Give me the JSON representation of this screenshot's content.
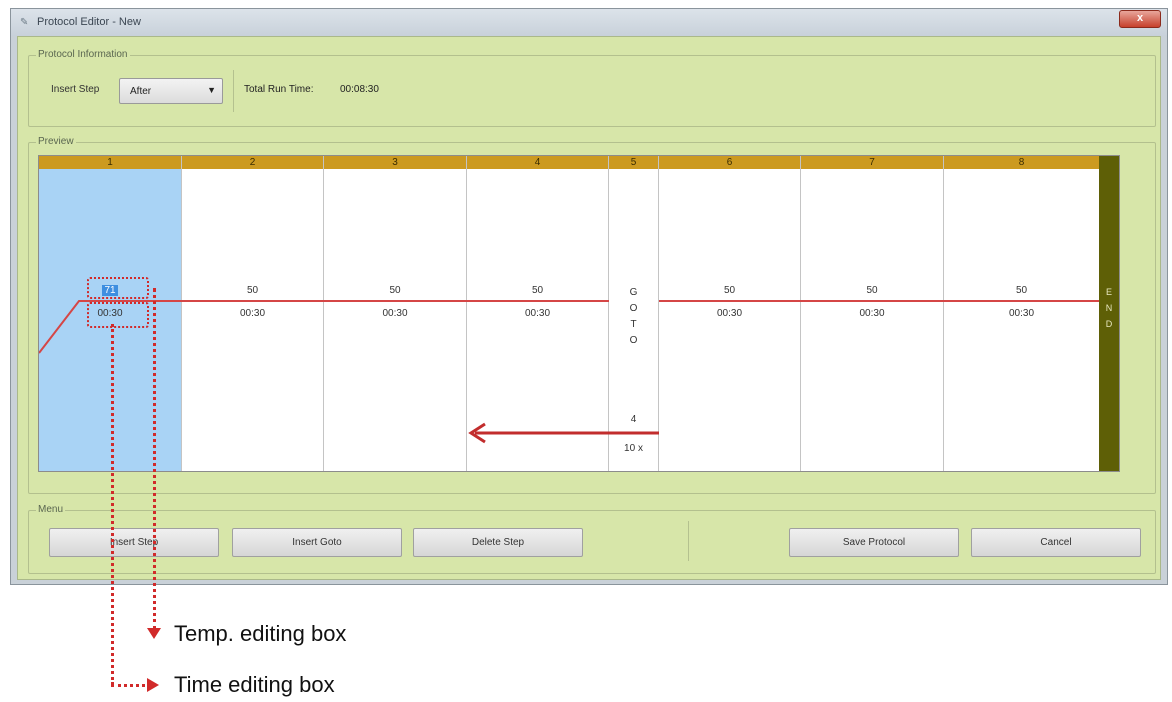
{
  "window": {
    "title": "Protocol Editor - New",
    "close_label": "x"
  },
  "protocol_info": {
    "group_title": "Protocol Information",
    "insert_step_label": "Insert Step",
    "insert_step_value": "After",
    "total_run_time_label": "Total Run Time:",
    "total_run_time_value": "00:08:30"
  },
  "preview": {
    "group_title": "Preview",
    "steps": [
      {
        "number": "1",
        "temp": "71",
        "time": "00:30",
        "selected": true
      },
      {
        "number": "2",
        "temp": "50",
        "time": "00:30"
      },
      {
        "number": "3",
        "temp": "50",
        "time": "00:30"
      },
      {
        "number": "4",
        "temp": "50",
        "time": "00:30"
      },
      {
        "number": "5",
        "goto_letters": [
          "G",
          "O",
          "T",
          "O"
        ],
        "goto_target": "4",
        "goto_repeat": "10 x"
      },
      {
        "number": "6",
        "temp": "50",
        "time": "00:30"
      },
      {
        "number": "7",
        "temp": "50",
        "time": "00:30"
      },
      {
        "number": "8",
        "temp": "50",
        "time": "00:30"
      }
    ],
    "end_letters": [
      "E",
      "N",
      "D"
    ]
  },
  "menu": {
    "group_title": "Menu",
    "insert_step": "Insert Step",
    "insert_goto": "Insert Goto",
    "delete_step": "Delete Step",
    "save_protocol": "Save Protocol",
    "cancel": "Cancel"
  },
  "annotations": {
    "temp_box": "Temp. editing box",
    "time_box": "Time editing box"
  },
  "colors": {
    "client_bg": "#d7e6a9",
    "header_gold": "#cc9a20",
    "selected_step": "#a9d3f5",
    "end_bar": "#5e5f06",
    "profile_line": "#d54646"
  }
}
